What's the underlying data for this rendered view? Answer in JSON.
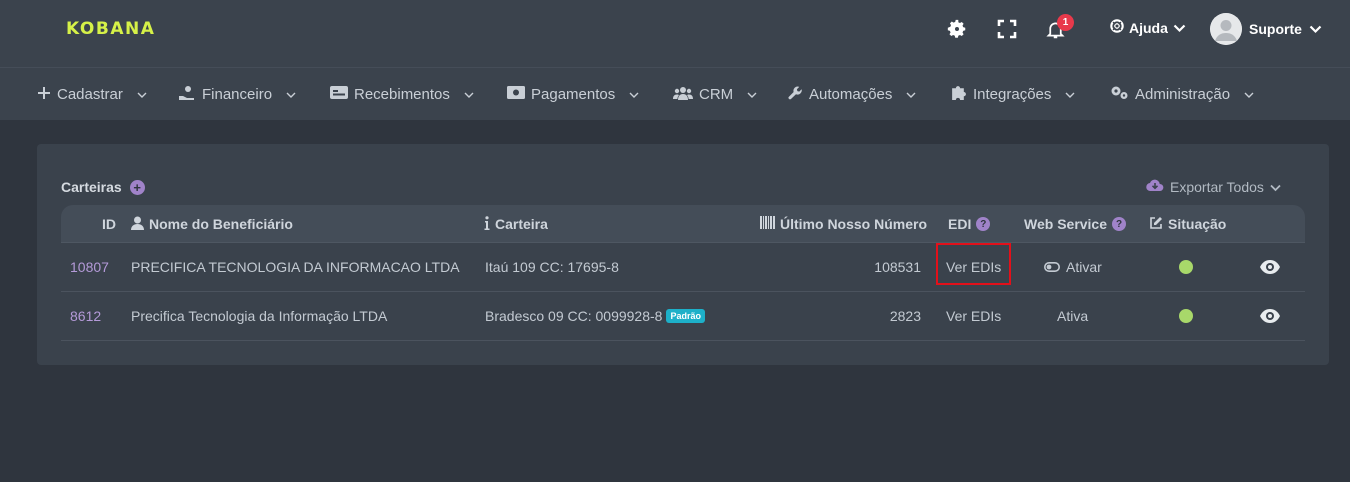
{
  "brand": {
    "logo_text": "KOBANA",
    "accent": "#d6f148"
  },
  "topbar": {
    "icons": [
      "gear-icon",
      "fullscreen-icon",
      "bell-icon"
    ],
    "notification_count": "1",
    "help_label": "Ajuda",
    "user_name": "Suporte"
  },
  "nav": {
    "items": [
      {
        "label": "Cadastrar",
        "icon": "plus-icon"
      },
      {
        "label": "Financeiro",
        "icon": "hand-money-icon"
      },
      {
        "label": "Recebimentos",
        "icon": "receipt-icon"
      },
      {
        "label": "Pagamentos",
        "icon": "money-bill-icon"
      },
      {
        "label": "CRM",
        "icon": "users-icon"
      },
      {
        "label": "Automações",
        "icon": "wrench-icon"
      },
      {
        "label": "Integrações",
        "icon": "puzzle-icon"
      },
      {
        "label": "Administração",
        "icon": "gears-icon"
      }
    ]
  },
  "card": {
    "title": "Carteiras",
    "export_label": "Exportar Todos",
    "columns": {
      "id": "ID",
      "beneficiary": "Nome do Beneficiário",
      "wallet": "Carteira",
      "last_number": "Último Nosso Número",
      "edi": "EDI",
      "web_service": "Web Service",
      "status": "Situação"
    },
    "rows": [
      {
        "id": "10807",
        "beneficiary": "PRECIFICA TECNOLOGIA DA INFORMACAO LTDA",
        "wallet": "Itaú 109 CC: 17695-8",
        "badge": "",
        "last_number": "108531",
        "edi": "Ver EDIs",
        "web_service": "Ativar",
        "status_color": "#a8d86a"
      },
      {
        "id": "8612",
        "beneficiary": "Precifica Tecnologia da Informação LTDA",
        "wallet": "Bradesco 09 CC: 0099928-8",
        "badge": "Padrão",
        "last_number": "2823",
        "edi": "Ver EDIs",
        "web_service": "Ativa",
        "status_color": "#a8d86a"
      }
    ]
  },
  "highlight_color": "#e3101a"
}
